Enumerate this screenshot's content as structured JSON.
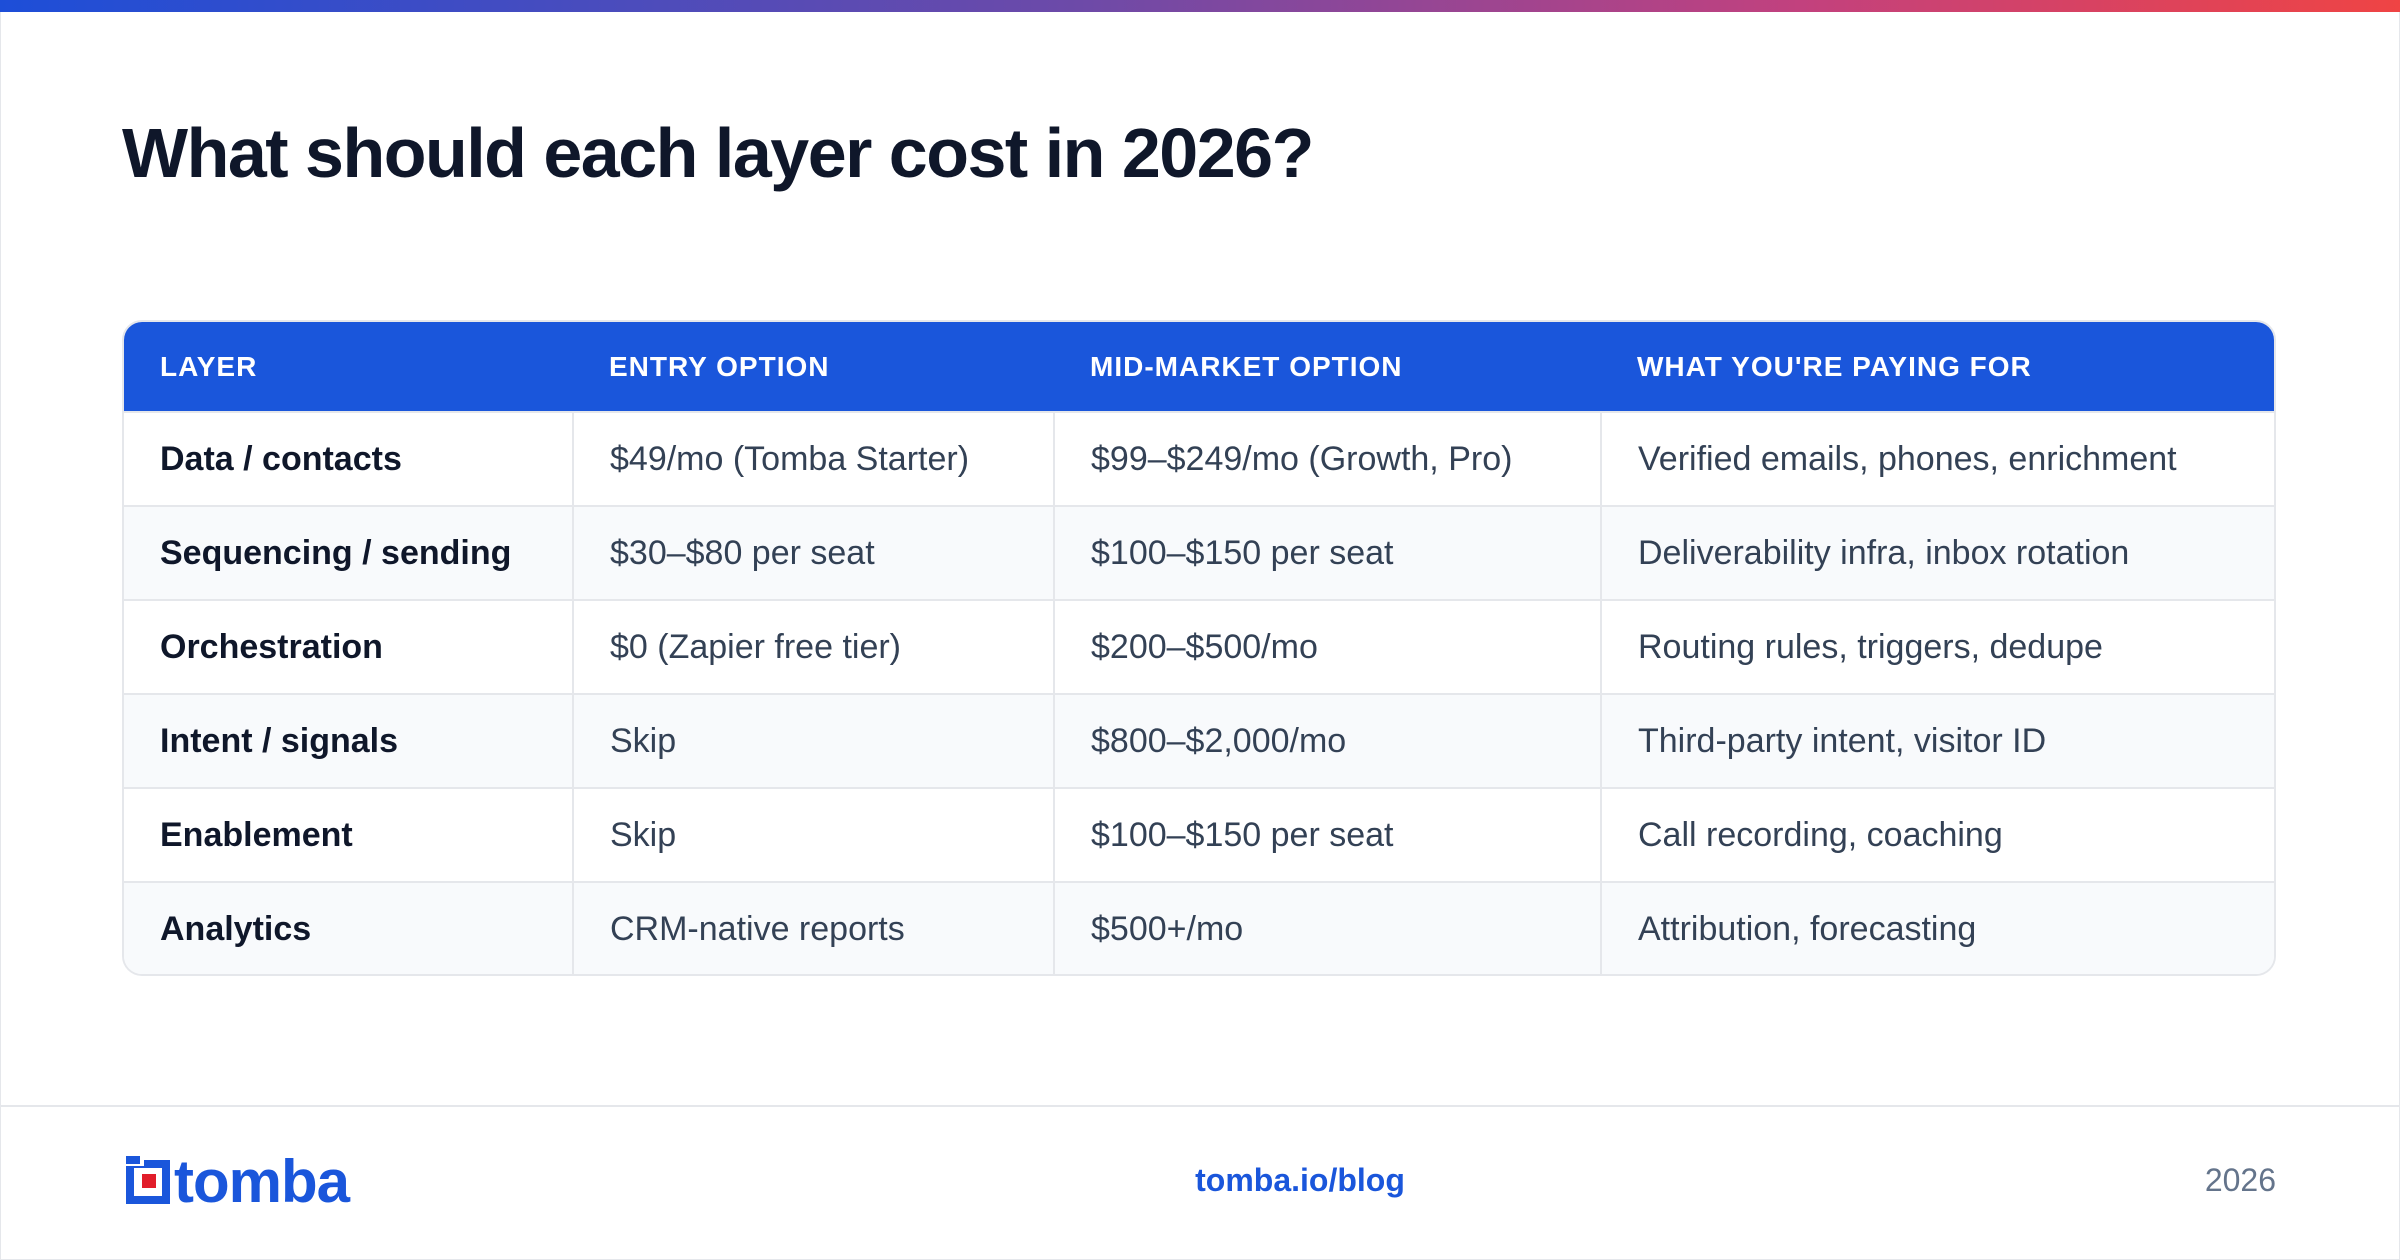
{
  "title": "What should each layer cost in 2026?",
  "table": {
    "headers": [
      "LAYER",
      "ENTRY OPTION",
      "MID-MARKET OPTION",
      "WHAT YOU'RE PAYING FOR"
    ],
    "rows": [
      [
        "Data / contacts",
        "$49/mo (Tomba Starter)",
        "$99–$249/mo (Growth, Pro)",
        "Verified emails, phones, enrichment"
      ],
      [
        "Sequencing / sending",
        "$30–$80 per seat",
        "$100–$150 per seat",
        "Deliverability infra, inbox rotation"
      ],
      [
        "Orchestration",
        "$0 (Zapier free tier)",
        "$200–$500/mo",
        "Routing rules, triggers, dedupe"
      ],
      [
        "Intent / signals",
        "Skip",
        "$800–$2,000/mo",
        "Third-party intent, visitor ID"
      ],
      [
        "Enablement",
        "Skip",
        "$100–$150 per seat",
        "Call recording, coaching"
      ],
      [
        "Analytics",
        "CRM-native reports",
        "$500+/mo",
        "Attribution, forecasting"
      ]
    ]
  },
  "footer": {
    "logo_text": "tomba",
    "link": "tomba.io/blog",
    "year": "2026"
  },
  "colors": {
    "brand_blue": "#1a56db",
    "logo_red": "#e11d2a",
    "title": "#0f172a"
  }
}
